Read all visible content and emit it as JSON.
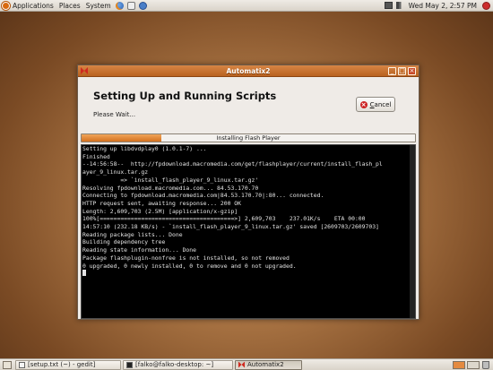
{
  "top_panel": {
    "menus": [
      "Applications",
      "Places",
      "System"
    ],
    "clock": "Wed May  2,  2:57 PM",
    "launchers": [
      "firefox-icon",
      "mail-icon",
      "help-icon"
    ]
  },
  "window": {
    "title": "Automatix2",
    "heading": "Setting Up and Running Scripts",
    "status": "Please Wait...",
    "cancel_label": "Cancel",
    "progress_label": "Installing Flash Player",
    "progress_fraction": 0.24,
    "terminal_lines": [
      "Setting up libdvdplay0 (1.0.1-7) ...",
      "",
      "Finished",
      "--14:56:58--  http://fpdownload.macromedia.com/get/flashplayer/current/install_flash_pl",
      "ayer_9_linux.tar.gz",
      "           => `install_flash_player_9_linux.tar.gz'",
      "Resolving fpdownload.macromedia.com... 84.53.170.70",
      "Connecting to fpdownload.macromedia.com|84.53.170.70|:80... connected.",
      "HTTP request sent, awaiting response... 200 OK",
      "Length: 2,609,703 (2.5M) [application/x-gzip]",
      "",
      "100%[=======================================>] 2,609,703    237.01K/s    ETA 00:00",
      "",
      "14:57:10 (232.18 KB/s) - `install_flash_player_9_linux.tar.gz' saved [2609703/2609703]",
      "",
      "Reading package lists... Done",
      "Building dependency tree",
      "Reading state information... Done",
      "Package flashplugin-nonfree is not installed, so not removed",
      "0 upgraded, 0 newly installed, 0 to remove and 0 not upgraded."
    ]
  },
  "taskbar": {
    "tasks": [
      {
        "label": "[setup.txt (~) - gedit]",
        "icon": "gedit-icon"
      },
      {
        "label": "[falko@falko-desktop: ~]",
        "icon": "terminal-icon"
      },
      {
        "label": "Automatix2",
        "icon": "automatix-icon"
      }
    ]
  },
  "colors": {
    "title_bar": "#c7702e",
    "progress_fill": "#e08a3c",
    "terminal_bg": "#000000",
    "terminal_fg": "#e4e4e4"
  }
}
